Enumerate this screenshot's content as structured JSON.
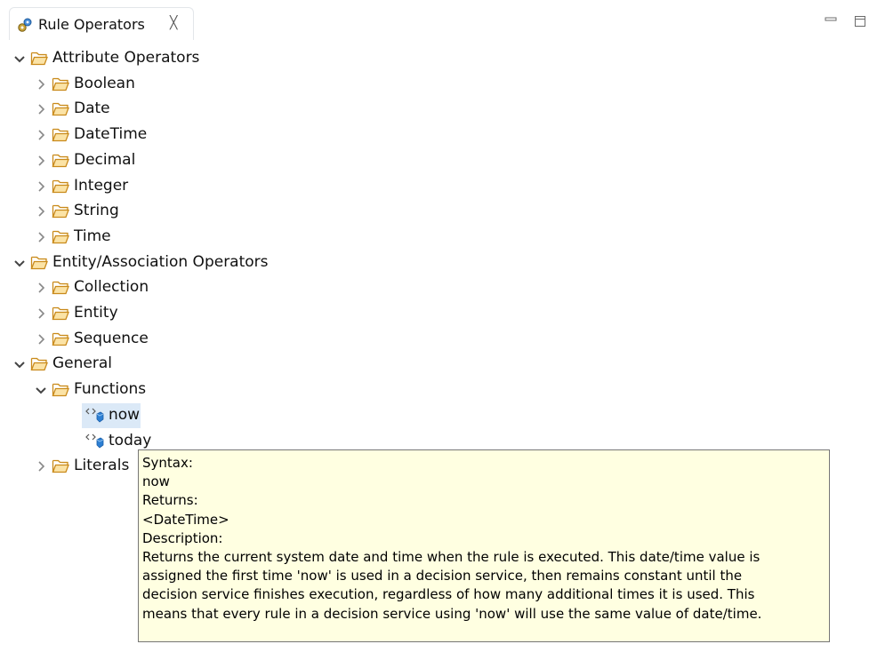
{
  "tab": {
    "title": "Rule Operators",
    "close_glyph": "╳",
    "icon": "gears-icon"
  },
  "window_controls": {
    "minimize": "minimize-icon",
    "maximize": "maximize-icon"
  },
  "tree": [
    {
      "label": "Attribute Operators",
      "level": 0,
      "expanded": true,
      "kind": "folder"
    },
    {
      "label": "Boolean",
      "level": 1,
      "expanded": false,
      "kind": "folder"
    },
    {
      "label": "Date",
      "level": 1,
      "expanded": false,
      "kind": "folder"
    },
    {
      "label": "DateTime",
      "level": 1,
      "expanded": false,
      "kind": "folder"
    },
    {
      "label": "Decimal",
      "level": 1,
      "expanded": false,
      "kind": "folder"
    },
    {
      "label": "Integer",
      "level": 1,
      "expanded": false,
      "kind": "folder"
    },
    {
      "label": "String",
      "level": 1,
      "expanded": false,
      "kind": "folder"
    },
    {
      "label": "Time",
      "level": 1,
      "expanded": false,
      "kind": "folder"
    },
    {
      "label": "Entity/Association Operators",
      "level": 0,
      "expanded": true,
      "kind": "folder"
    },
    {
      "label": "Collection",
      "level": 1,
      "expanded": false,
      "kind": "folder"
    },
    {
      "label": "Entity",
      "level": 1,
      "expanded": false,
      "kind": "folder"
    },
    {
      "label": "Sequence",
      "level": 1,
      "expanded": false,
      "kind": "folder"
    },
    {
      "label": "General",
      "level": 0,
      "expanded": true,
      "kind": "folder"
    },
    {
      "label": "Functions",
      "level": 1,
      "expanded": true,
      "kind": "folder"
    },
    {
      "label": "now",
      "level": 2,
      "kind": "function",
      "selected": true
    },
    {
      "label": "today",
      "level": 2,
      "kind": "function"
    },
    {
      "label": "Literals",
      "level": 1,
      "expanded": false,
      "kind": "folder"
    }
  ],
  "tooltip": {
    "lines": [
      "Syntax:",
      "now",
      "Returns:",
      "<DateTime>",
      "Description:",
      "Returns the current system date and time when the rule is executed. This date/time value is",
      "assigned the first time 'now' is used in a decision service, then remains constant until the",
      "decision service finishes execution, regardless of how many additional times it is used. This",
      "means that every rule in a decision service using 'now' will use the same value of date/time."
    ]
  },
  "colors": {
    "selection": "#dbe9f7",
    "tooltip_bg": "#ffffe1",
    "folder": "#e8a23a",
    "function_icon": "#2d7fd3"
  }
}
